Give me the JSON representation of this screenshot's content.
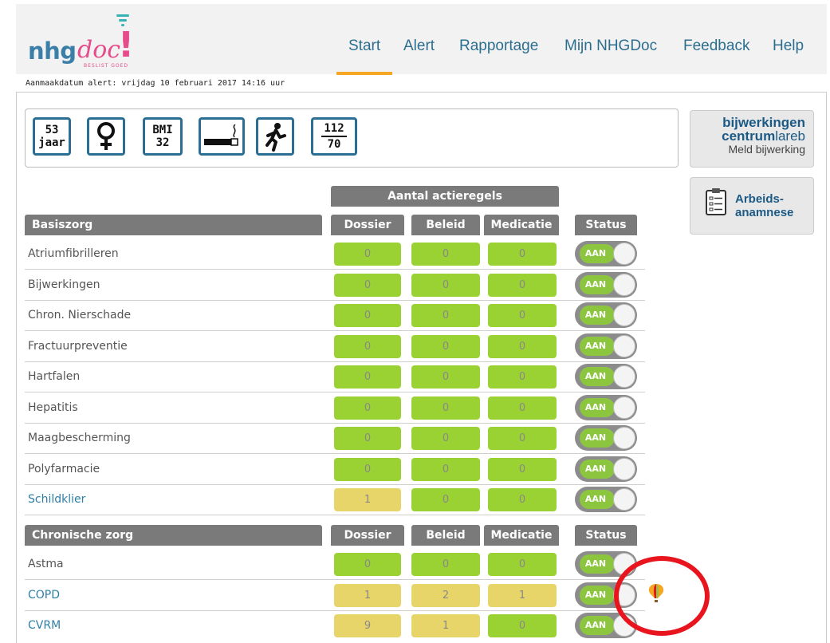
{
  "logo": {
    "main": "nhg",
    "doc": "doc",
    "excl": "!",
    "sub": "BESLIST GOED"
  },
  "nav": [
    "Start",
    "Alert",
    "Rapportage",
    "Mijn NHGDoc",
    "Feedback",
    "Help"
  ],
  "created": "Aanmaakdatum alert: vrijdag 10 februari 2017 14:16 uur",
  "patient": {
    "age_value": "53",
    "age_unit": "jaar",
    "bmi_label": "BMI",
    "bmi_value": "32",
    "bp_sys": "112",
    "bp_dia": "70",
    "icons": [
      "female-icon",
      "smoking-icon",
      "running-icon"
    ]
  },
  "side": {
    "bij_l1": "bijwerkingen",
    "bij_l2a": "centrum",
    "bij_l2b": "lareb",
    "bij_l3": "Meld bijwerking",
    "arb_l1": "Arbeids-",
    "arb_l2": "anamnese"
  },
  "table": {
    "group_header": "Aantal actieregels",
    "cols": [
      "Dossier",
      "Beleid",
      "Medicatie",
      "Status"
    ],
    "toggle_label": "AAN",
    "sections": [
      {
        "title": "Basiszorg",
        "rows": [
          {
            "label": "Atriumfibrilleren",
            "values": [
              "0",
              "0",
              "0"
            ],
            "colors": [
              "g",
              "g",
              "g"
            ],
            "link": false
          },
          {
            "label": "Bijwerkingen",
            "values": [
              "0",
              "0",
              "0"
            ],
            "colors": [
              "g",
              "g",
              "g"
            ],
            "link": false
          },
          {
            "label": "Chron. Nierschade",
            "values": [
              "0",
              "0",
              "0"
            ],
            "colors": [
              "g",
              "g",
              "g"
            ],
            "link": false
          },
          {
            "label": "Fractuurpreventie",
            "values": [
              "0",
              "0",
              "0"
            ],
            "colors": [
              "g",
              "g",
              "g"
            ],
            "link": false
          },
          {
            "label": "Hartfalen",
            "values": [
              "0",
              "0",
              "0"
            ],
            "colors": [
              "g",
              "g",
              "g"
            ],
            "link": false
          },
          {
            "label": "Hepatitis",
            "values": [
              "0",
              "0",
              "0"
            ],
            "colors": [
              "g",
              "g",
              "g"
            ],
            "link": false
          },
          {
            "label": "Maagbescherming",
            "values": [
              "0",
              "0",
              "0"
            ],
            "colors": [
              "g",
              "g",
              "g"
            ],
            "link": false
          },
          {
            "label": "Polyfarmacie",
            "values": [
              "0",
              "0",
              "0"
            ],
            "colors": [
              "g",
              "g",
              "g"
            ],
            "link": false
          },
          {
            "label": "Schildklier",
            "values": [
              "1",
              "0",
              "0"
            ],
            "colors": [
              "y",
              "g",
              "g"
            ],
            "link": true
          }
        ]
      },
      {
        "title": "Chronische zorg",
        "rows": [
          {
            "label": "Astma",
            "values": [
              "0",
              "0",
              "0"
            ],
            "colors": [
              "g",
              "g",
              "g"
            ],
            "link": false
          },
          {
            "label": "COPD",
            "values": [
              "1",
              "2",
              "1"
            ],
            "colors": [
              "y",
              "y",
              "y"
            ],
            "link": true
          },
          {
            "label": "CVRM",
            "values": [
              "9",
              "1",
              "0"
            ],
            "colors": [
              "y",
              "y",
              "g"
            ],
            "link": true
          }
        ]
      }
    ]
  },
  "colors": {
    "accent": "#f5a623",
    "brand": "#2a6f93",
    "green": "#9bd233",
    "yellow": "#e8d56a",
    "annotation": "#e8141e"
  }
}
